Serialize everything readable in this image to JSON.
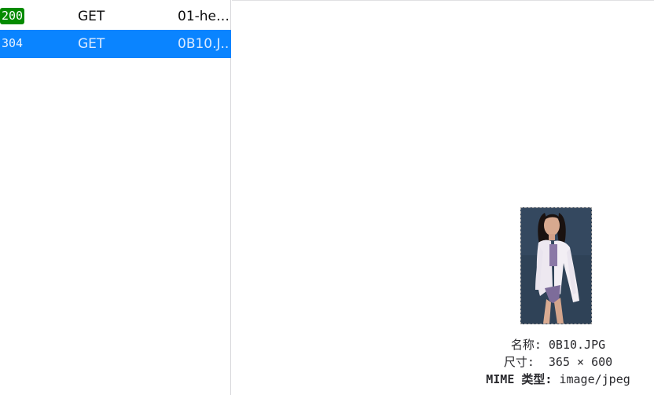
{
  "requests": [
    {
      "status": "200",
      "method": "GET",
      "file": "01-hell.."
    },
    {
      "status": "304",
      "method": "GET",
      "file": "0B10.J.."
    }
  ],
  "preview": {
    "name_label": "名称:",
    "name_value": "0B10.JPG",
    "size_label": "尺寸:",
    "size_value": "365 × 600",
    "mime_label": "MIME 类型:",
    "mime_value": "image/jpeg"
  },
  "colors": {
    "selected_row": "#0a84ff",
    "status_ok": "#058b00"
  },
  "icons": {
    "preview_image": "photo-thumbnail"
  }
}
